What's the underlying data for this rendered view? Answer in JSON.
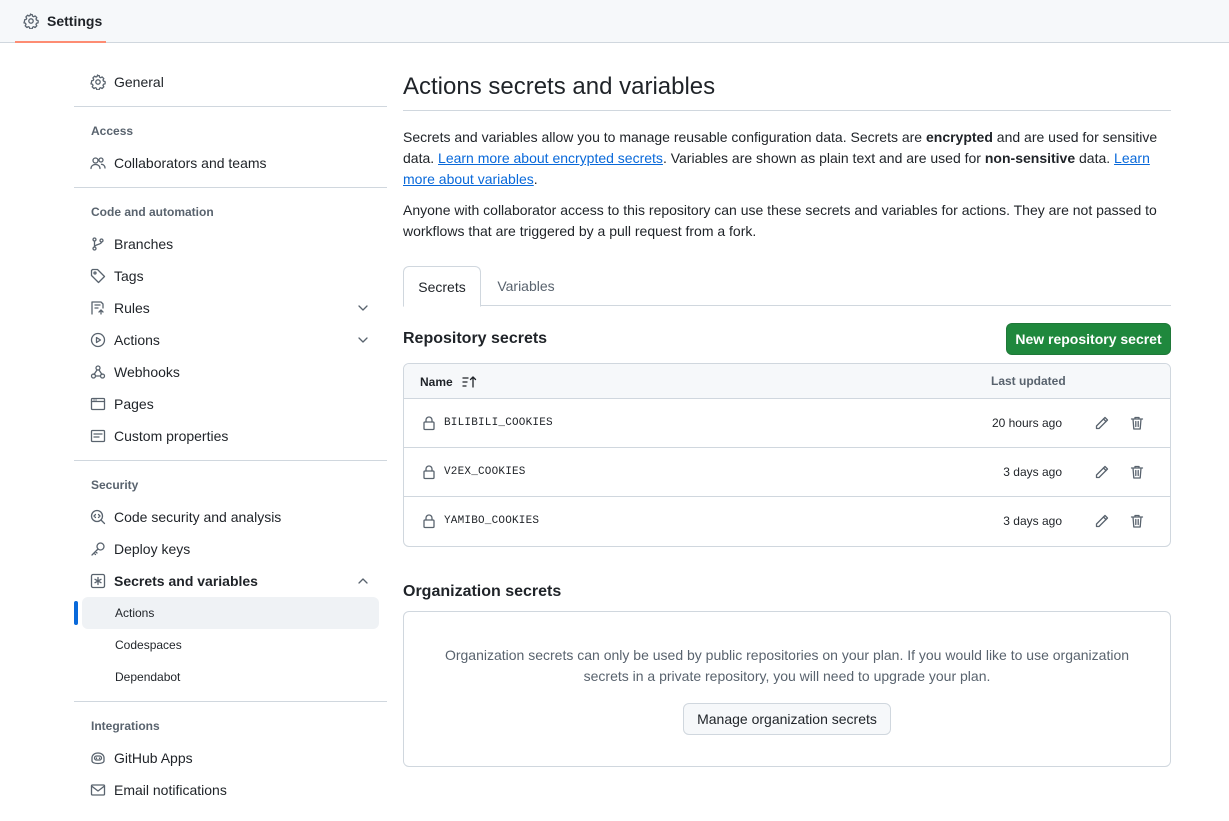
{
  "topbar": {
    "tab_label": "Settings"
  },
  "sidebar": {
    "general": "General",
    "groups": {
      "access": "Access",
      "code_automation": "Code and automation",
      "security": "Security",
      "integrations": "Integrations"
    },
    "items": {
      "collaborators": "Collaborators and teams",
      "branches": "Branches",
      "tags": "Tags",
      "rules": "Rules",
      "actions": "Actions",
      "webhooks": "Webhooks",
      "pages": "Pages",
      "custom_properties": "Custom properties",
      "code_security": "Code security and analysis",
      "deploy_keys": "Deploy keys",
      "secrets_variables": "Secrets and variables",
      "github_apps": "GitHub Apps",
      "email_notifications": "Email notifications"
    },
    "sub_items": {
      "actions": "Actions",
      "codespaces": "Codespaces",
      "dependabot": "Dependabot"
    }
  },
  "main": {
    "title": "Actions secrets and variables",
    "intro": {
      "p1": "Secrets and variables allow you to manage reusable configuration data. Secrets are ",
      "p1_bold": "encrypted",
      "p2": " and are used for sensitive data. ",
      "link1": "Learn more about encrypted secrets",
      "p3": ". Variables are shown as plain text and are used for ",
      "p3_bold": "non-sensitive",
      "p4": " data. ",
      "link2": "Learn more about variables",
      "p5": "."
    },
    "note": "Anyone with collaborator access to this repository can use these secrets and variables for actions. They are not passed to workflows that are triggered by a pull request from a fork.",
    "tabs": {
      "secrets": "Secrets",
      "variables": "Variables"
    },
    "repo_secrets": {
      "title": "Repository secrets",
      "new_button": "New repository secret",
      "col_name": "Name",
      "col_updated": "Last updated",
      "rows": [
        {
          "name": "BILIBILI_COOKIES",
          "updated": "20 hours ago"
        },
        {
          "name": "V2EX_COOKIES",
          "updated": "3 days ago"
        },
        {
          "name": "YAMIBO_COOKIES",
          "updated": "3 days ago"
        }
      ]
    },
    "org_secrets": {
      "title": "Organization secrets",
      "message": "Organization secrets can only be used by public repositories on your plan. If you would like to use organization secrets in a private repository, you will need to upgrade your plan.",
      "manage_button": "Manage organization secrets"
    }
  },
  "colors": {
    "accent_link": "#0969da",
    "primary_button": "#1f883d",
    "tab_underline": "#fd8c73"
  }
}
